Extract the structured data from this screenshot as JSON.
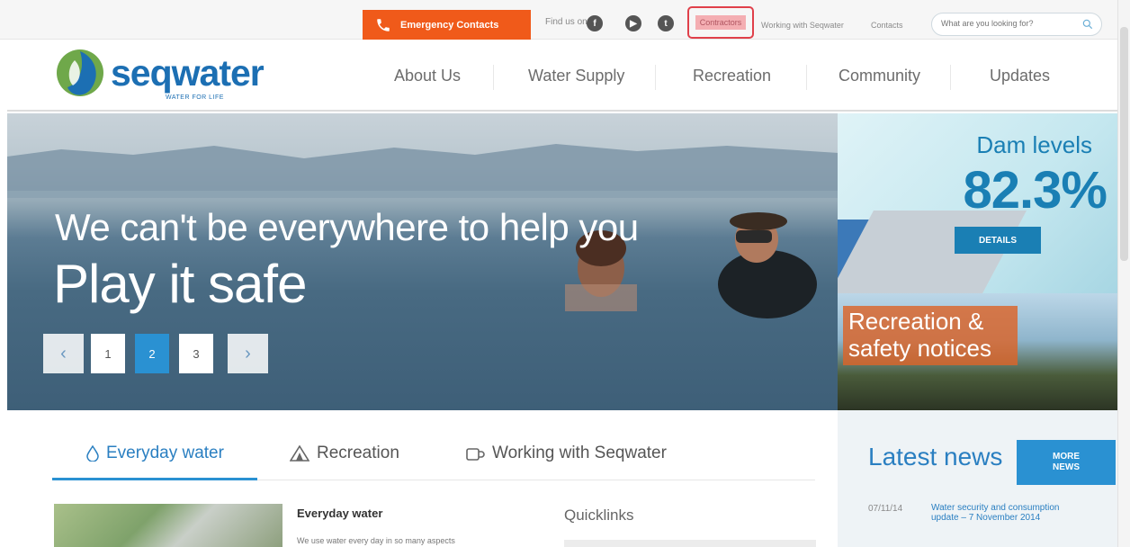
{
  "utility_bar": {
    "emergency_label": "Emergency Contacts",
    "find_us_label": "Find us on",
    "social_icons": [
      "facebook-icon",
      "youtube-icon",
      "twitter-icon"
    ],
    "links": [
      "Contractors",
      "Working with Seqwater",
      "Contacts"
    ],
    "search_placeholder": "What are you looking for?"
  },
  "header": {
    "brand": "seqwater",
    "tagline": "WATER FOR LIFE",
    "nav": [
      "About Us",
      "Water Supply",
      "Recreation",
      "Community",
      "Updates"
    ]
  },
  "hero": {
    "headline": "We can't be everywhere to help you",
    "subheadline": "Play it safe",
    "pagination": [
      "1",
      "2",
      "3"
    ],
    "active_page": "2"
  },
  "dam_levels": {
    "label": "Dam levels",
    "value": "82.3%",
    "button": "DETAILS"
  },
  "recreation_card": {
    "line1": "Recreation &",
    "line2": "safety notices"
  },
  "tabs": [
    "Everyday water",
    "Recreation",
    "Working with Seqwater"
  ],
  "content": {
    "title": "Everyday water",
    "text": "We use water every day in so many aspects",
    "quicklinks": "Quicklinks"
  },
  "news": {
    "title": "Latest news",
    "more_line1": "MORE",
    "more_line2": "NEWS",
    "items": [
      {
        "date": "07/11/14",
        "text": "Water security and consumption update – 7 November 2014"
      }
    ]
  },
  "colors": {
    "accent_blue": "#2a91d2",
    "emergency_orange": "#f05a1a",
    "brand_blue": "#1c6fb3"
  }
}
